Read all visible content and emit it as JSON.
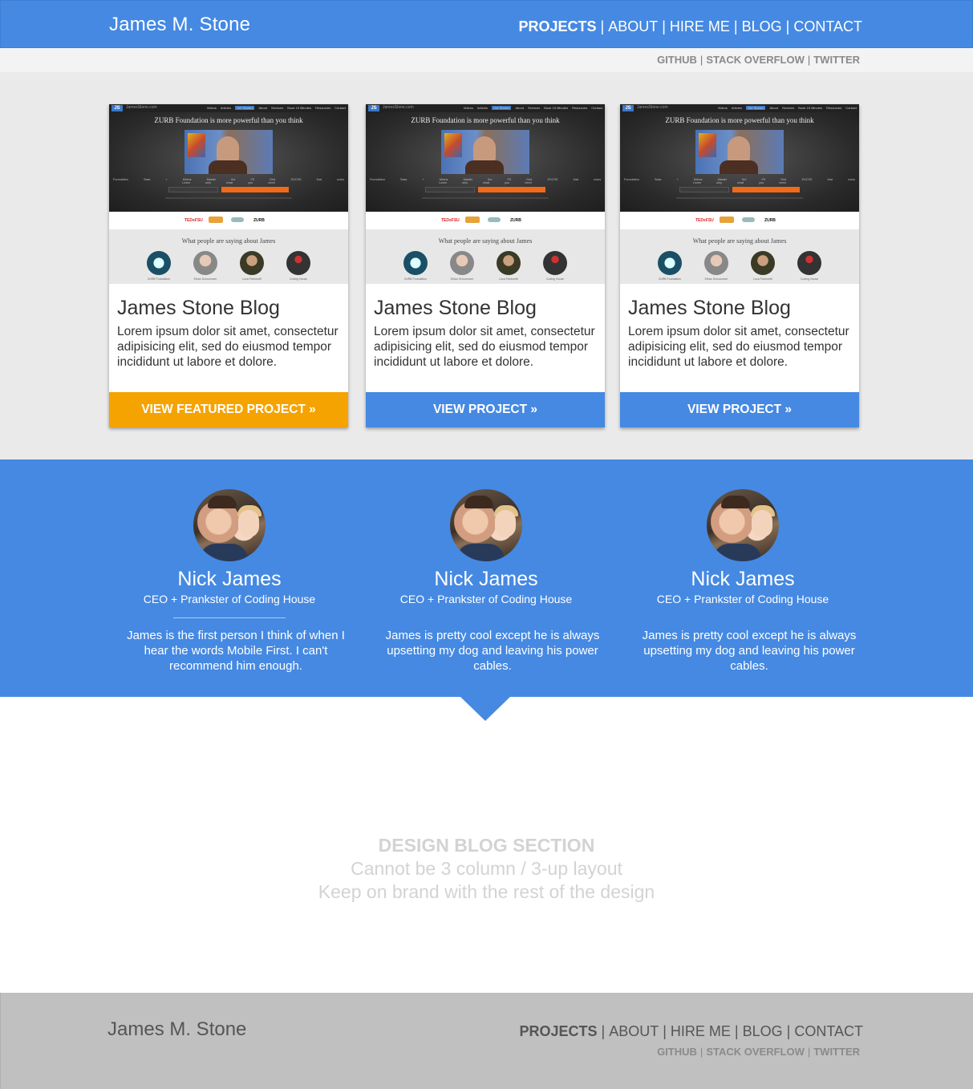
{
  "header": {
    "brand": "James M. Stone",
    "nav": [
      "PROJECTS",
      "ABOUT",
      "HIRE ME",
      "BLOG",
      "CONTACT"
    ],
    "social": [
      "GITHUB",
      "STACK OVERFLOW",
      "TWITTER"
    ]
  },
  "projects": [
    {
      "title": "James Stone Blog",
      "description": "Lorem ipsum dolor sit amet, consectetur adipisicing elit, sed do eiusmod tempor incididunt ut labore et dolore.",
      "button": "VIEW FEATURED PROJECT »"
    },
    {
      "title": "James Stone Blog",
      "description": "Lorem ipsum dolor sit amet, consectetur adipisicing elit, sed do eiusmod tempor incididunt ut labore et dolore.",
      "button": "VIEW PROJECT »"
    },
    {
      "title": "James Stone Blog",
      "description": "Lorem ipsum dolor sit amet, consectetur adipisicing elit, sed do eiusmod tempor incididunt ut labore et dolore.",
      "button": "VIEW PROJECT »"
    }
  ],
  "screenshot": {
    "logo": "JS",
    "site_name": "JamesStone.com",
    "menu": [
      "Videos",
      "Articles",
      "Get Started",
      "About",
      "Services",
      "Book 15 Minutes",
      "Resources",
      "Contact"
    ],
    "headline": "ZURB Foundation is more powerful than you think",
    "features": [
      "Foundation Sass + Mixins",
      "Master the F5 Grid",
      "JS/CSS that rocks",
      "Learn only what you need"
    ],
    "email_placeholder": "Your Email",
    "email_button": "SEND ME THE COURSE BY EMAIL »",
    "sponsor_logos": [
      "TEDxFSU",
      "",
      "",
      "ZURB"
    ],
    "testimonials_title": "What people are saying about James",
    "testimonial_names": [
      "ZURB Foundation",
      "Ethan Schoonover",
      "Luca Pantoretti",
      "Coding House"
    ]
  },
  "testimonials": [
    {
      "name": "Nick James",
      "role": "CEO + Prankster of Coding House",
      "quote": "James is the first person I think of when I hear the words Mobile First. I can't recommend him enough."
    },
    {
      "name": "Nick James",
      "role": "CEO + Prankster of Coding House",
      "quote": "James is pretty cool except he is always upsetting my dog and leaving his power cables."
    },
    {
      "name": "Nick James",
      "role": "CEO + Prankster of Coding House",
      "quote": "James is pretty cool except he is always upsetting my dog and leaving his power cables."
    }
  ],
  "blog": {
    "line1": "DESIGN BLOG SECTION",
    "line2": "Cannot be 3 column / 3-up layout",
    "line3": "Keep on brand with the rest of the design"
  },
  "footer": {
    "brand": "James M. Stone",
    "nav": [
      "PROJECTS",
      "ABOUT",
      "HIRE ME",
      "BLOG",
      "CONTACT"
    ],
    "social": [
      "GITHUB",
      "STACK OVERFLOW",
      "TWITTER"
    ]
  },
  "colors": {
    "primary": "#4589e2",
    "featured": "#f5a300",
    "footer": "#c0c0c0",
    "section_bg": "#ebeaea"
  }
}
